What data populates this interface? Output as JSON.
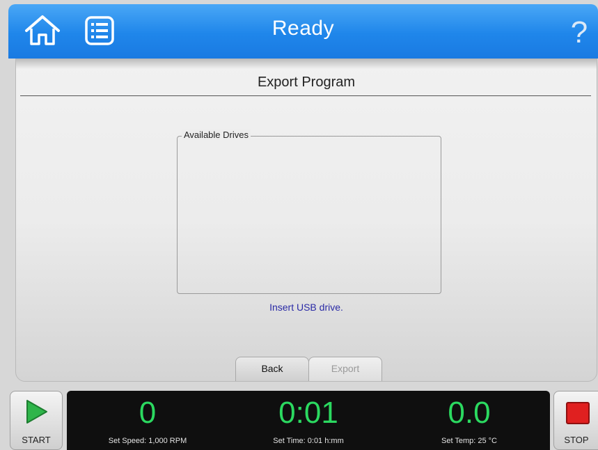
{
  "header": {
    "title": "Ready",
    "home_icon": "home-icon",
    "menu_icon": "menu-list-icon",
    "help_label": "?"
  },
  "panel": {
    "title": "Export Program",
    "drives_legend": "Available Drives",
    "drives": [],
    "insert_message": "Insert USB drive."
  },
  "buttons": {
    "back_label": "Back",
    "export_label": "Export"
  },
  "footer": {
    "start_label": "START",
    "stop_label": "STOP",
    "speed_value": "0",
    "speed_label": "Set Speed: 1,000 RPM",
    "time_value": "0:01",
    "time_label": "Set Time: 0:01 h:mm",
    "temp_value": "0.0",
    "temp_label": "Set Temp: 25 °C"
  },
  "colors": {
    "header_blue": "#1f86ea",
    "readout_green": "#2bd960",
    "message_blue": "#2a2aa6",
    "start_green": "#2fb54a",
    "stop_red": "#e02020"
  }
}
